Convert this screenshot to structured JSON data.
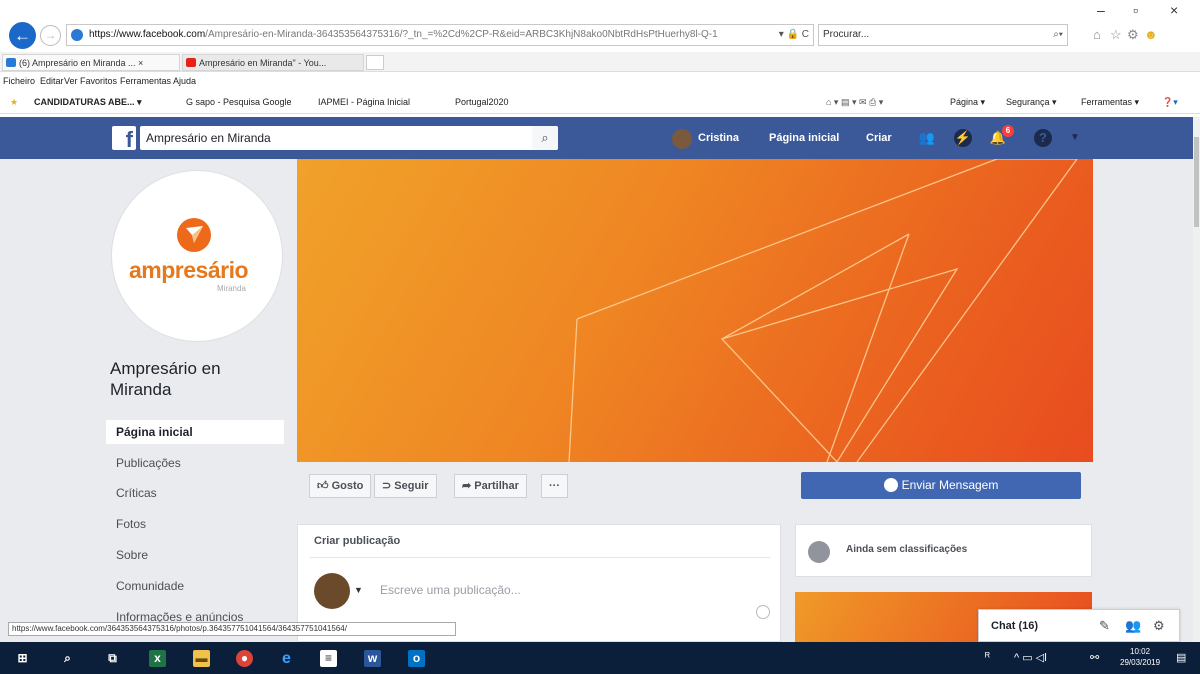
{
  "browser": {
    "url_domain": "https://www.facebook.com",
    "url_path": "/Ampresário-en-Miranda-364353564375316/?_tn_=%2Cd%2CP-R&eid=ARBC3KhjN8ako0NbtRdHsPtHuerhy8l-Q-1",
    "address_tail": "▾ 🔒 C",
    "search_placeholder": "Procurar...",
    "tabs": [
      {
        "label": "(6) Ampresário en Miranda ...  ×",
        "icon_color": "#2a79d4"
      },
      {
        "label": "Ampresário en Miranda\" - You...",
        "icon_color": "#e62117"
      }
    ],
    "menu": [
      "Ficheiro",
      "Editar",
      "Ver",
      "Favoritos",
      "Ferramentas",
      "Ajuda"
    ],
    "favorites": [
      "CANDIDATURAS ABE...  ▾",
      "G sapo - Pesquisa Google",
      "IAPMEI - Página Inicial",
      "Portugal2020"
    ],
    "commandbar": [
      "Página ▾",
      "Segurança ▾",
      "Ferramentas ▾"
    ],
    "status_url": "https://www.facebook.com/364353564375316/photos/p.364357751041564/364357751041564/"
  },
  "facebook": {
    "logo": "f",
    "search_value": "Ampresário en Miranda",
    "user_name": "Cristina",
    "nav_home": "Página inicial",
    "nav_create": "Criar",
    "notification_count": "6"
  },
  "page": {
    "logo_text": "ampresário",
    "logo_sub": "Miranda",
    "name": "Ampresário en Miranda",
    "sidebar": [
      {
        "label": "Página inicial",
        "active": true
      },
      {
        "label": "Publicações"
      },
      {
        "label": "Críticas"
      },
      {
        "label": "Fotos"
      },
      {
        "label": "Sobre"
      },
      {
        "label": "Comunidade"
      },
      {
        "label": "Informações e anúncios"
      }
    ],
    "actions": {
      "like": "Gosto",
      "follow": "Seguir",
      "share": "Partilhar",
      "more": "···",
      "message": "Enviar Mensagem"
    },
    "post": {
      "title": "Criar publicação",
      "placeholder": "Escreve uma publicação..."
    },
    "rating": "Ainda sem classificações",
    "chat": "Chat (16)"
  },
  "taskbar": {
    "time": "10:02",
    "date": "29/03/2019"
  },
  "colors": {
    "facebook_blue": "#3b5998",
    "button_blue": "#4267b2",
    "cover_orange": "#ef8623",
    "taskbar": "#0b1f3a"
  }
}
